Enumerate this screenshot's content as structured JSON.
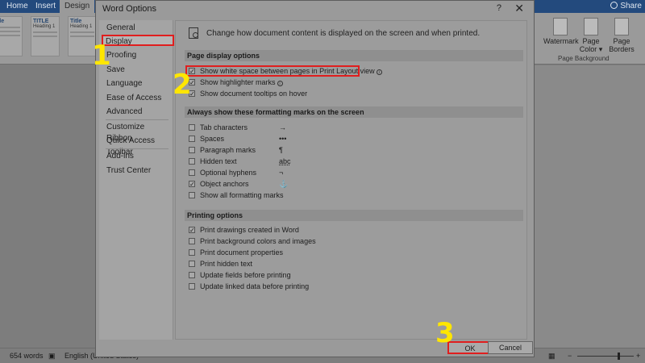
{
  "ribbon": {
    "tabs": [
      "Home",
      "Insert",
      "Design"
    ],
    "share": "Share",
    "themes": [
      {
        "title": "itle",
        "sub": ""
      },
      {
        "title": "TITLE",
        "sub": "Heading 1"
      },
      {
        "title": "Title",
        "sub": "Heading 1"
      }
    ],
    "buttons": [
      "Watermark",
      "Page Color ▾",
      "Page Borders"
    ],
    "group_label": "Page Background"
  },
  "statusbar": {
    "words": "654 words",
    "language": "English (United States)"
  },
  "dialog": {
    "title": "Word Options",
    "help": "?",
    "close": "✕",
    "nav": [
      {
        "label": "General"
      },
      {
        "label": "Display"
      },
      {
        "label": "Proofing"
      },
      {
        "label": "Save"
      },
      {
        "label": "Language"
      },
      {
        "label": "Ease of Access"
      },
      {
        "label": "Advanced"
      },
      {
        "label": "Customize Ribbon"
      },
      {
        "label": "Quick Access Toolbar"
      },
      {
        "label": "Add-ins"
      },
      {
        "label": "Trust Center"
      }
    ],
    "intro": "Change how document content is displayed on the screen and when printed.",
    "sections": {
      "page_display": {
        "header": "Page display options",
        "options": [
          {
            "label": "Show white space between pages in Print Layout view",
            "checked": true
          },
          {
            "label": "Show highlighter marks",
            "checked": true
          },
          {
            "label": "Show document tooltips on hover",
            "checked": true
          }
        ]
      },
      "formatting_marks": {
        "header": "Always show these formatting marks on the screen",
        "options": [
          {
            "label": "Tab characters",
            "symbol": "→",
            "checked": false
          },
          {
            "label": "Spaces",
            "symbol": "•••",
            "checked": false
          },
          {
            "label": "Paragraph marks",
            "symbol": "¶",
            "checked": false
          },
          {
            "label": "Hidden text",
            "symbol": "abc",
            "checked": false
          },
          {
            "label": "Optional hyphens",
            "symbol": "¬",
            "checked": false
          },
          {
            "label": "Object anchors",
            "symbol": "⚓",
            "checked": true
          },
          {
            "label": "Show all formatting marks",
            "symbol": "",
            "checked": false
          }
        ]
      },
      "printing": {
        "header": "Printing options",
        "options": [
          {
            "label": "Print drawings created in Word",
            "checked": true
          },
          {
            "label": "Print background colors and images",
            "checked": false
          },
          {
            "label": "Print document properties",
            "checked": false
          },
          {
            "label": "Print hidden text",
            "checked": false
          },
          {
            "label": "Update fields before printing",
            "checked": false
          },
          {
            "label": "Update linked data before printing",
            "checked": false
          }
        ]
      }
    },
    "ok_label": "OK",
    "cancel_label": "Cancel"
  },
  "annotations": {
    "step1": "1",
    "step2": "2",
    "step3": "3",
    "highlight_color": "#e01e1e",
    "step_color": "#ffe600"
  }
}
